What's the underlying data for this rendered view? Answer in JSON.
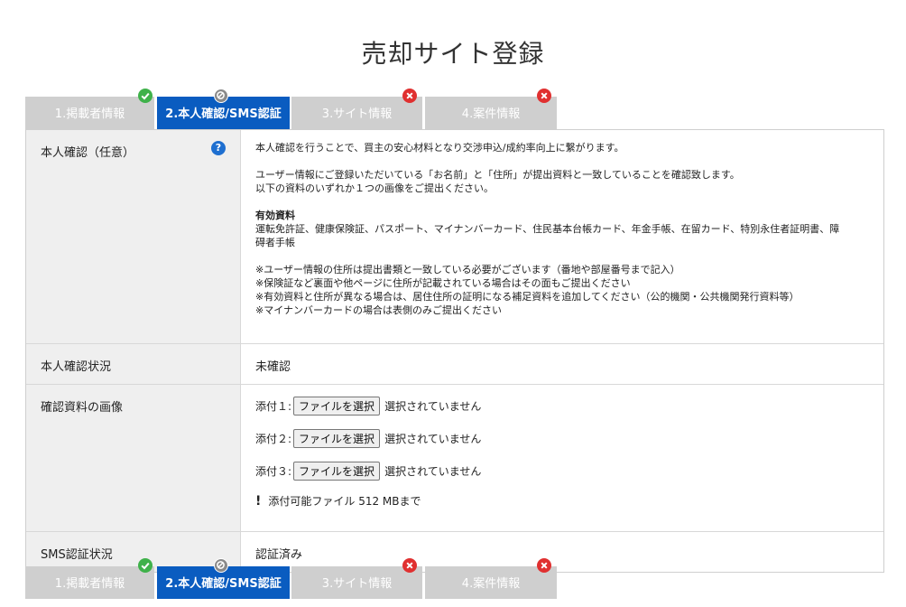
{
  "page": {
    "title": "売却サイト登録"
  },
  "tabs": [
    {
      "label": "1.掲載者情報",
      "status": "ok"
    },
    {
      "label": "2.本人確認/SMS認証",
      "status": "pending"
    },
    {
      "label": "3.サイト情報",
      "status": "ng"
    },
    {
      "label": "4.案件情報",
      "status": "ng"
    }
  ],
  "identity": {
    "label": "本人確認（任意）",
    "help_icon": "?",
    "intro": "本人確認を行うことで、買主の安心材料となり交渉申込/成約率向上に繋がります。",
    "match_line1": "ユーザー情報にご登録いただいている「お名前」と「住所」が提出資料と一致していることを確認致します。",
    "match_line2": "以下の資料のいずれか１つの画像をご提出ください。",
    "valid_heading": "有効資料",
    "valid_line1": "運転免許証、健康保険証、パスポート、マイナンバーカード、住民基本台帳カード、年金手帳、在留カード、特別永住者証明書、障",
    "valid_line2": "碍者手帳",
    "note1": "※ユーザー情報の住所は提出書類と一致している必要がございます（番地や部屋番号まで記入）",
    "note2": "※保険証など裏面や他ページに住所が記載されている場合はその面もご提出ください",
    "note3": "※有効資料と住所が異なる場合は、居住住所の証明になる補足資料を追加してください（公的機関・公共機関発行資料等）",
    "note4": "※マイナンバーカードの場合は表側のみご提出ください"
  },
  "status_row": {
    "label": "本人確認状況",
    "value": "未確認"
  },
  "images_row": {
    "label": "確認資料の画像",
    "files": [
      {
        "label": "添付１:",
        "button": "ファイルを選択",
        "status": "選択されていません"
      },
      {
        "label": "添付２:",
        "button": "ファイルを選択",
        "status": "選択されていません"
      },
      {
        "label": "添付３:",
        "button": "ファイルを選択",
        "status": "選択されていません"
      }
    ],
    "limit_icon": "!",
    "limit_text": "添付可能ファイル 512 MBまで"
  },
  "sms_row": {
    "label": "SMS認証状況",
    "value": "認証済み"
  },
  "colors": {
    "active_tab": "#0a5cc0",
    "inactive_tab": "#cfcfcf",
    "ok": "#3fb14a",
    "ng": "#e03030",
    "pending": "#8a8a8a",
    "help": "#1e6fd0"
  }
}
